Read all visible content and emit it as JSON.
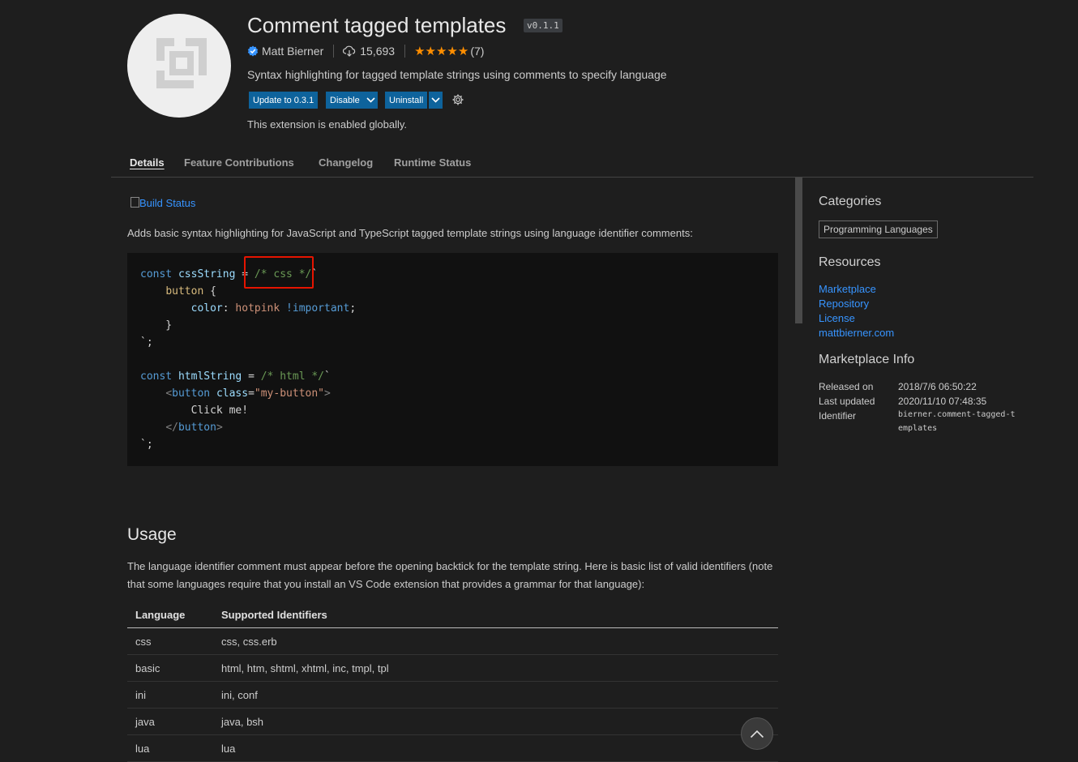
{
  "header": {
    "title": "Comment tagged templates",
    "version": "v0.1.1",
    "publisher": "Matt Bierner",
    "install_count": "15,693",
    "rating_stars": "★★★★★",
    "rating_count": "(7)",
    "description": "Syntax highlighting for tagged template strings using comments to specify language",
    "update_label": "Update to 0.3.1",
    "disable_label": "Disable",
    "uninstall_label": "Uninstall",
    "status_text": "This extension is enabled globally.",
    "icon_names": [
      "verified-publisher-icon",
      "cloud-download-icon",
      "chevron-down-icon",
      "gear-icon",
      "chevron-up-icon"
    ]
  },
  "tabs": [
    {
      "label": "Details",
      "active": true
    },
    {
      "label": "Feature Contributions",
      "active": false
    },
    {
      "label": "Changelog",
      "active": false
    },
    {
      "label": "Runtime Status",
      "active": false
    }
  ],
  "content": {
    "build_badge_alt": "Build Status",
    "intro": "Adds basic syntax highlighting for JavaScript and TypeScript tagged template strings using language identifier comments:",
    "code_text": "const cssString = /* css */`\n    button {\n        color: hotpink !important;\n    }\n`;\n\nconst htmlString = /* html */`\n    <button class=\"my-button\">\n        Click me!\n    </button>\n`;",
    "usage_heading": "Usage",
    "usage_text": "The language identifier comment must appear before the opening backtick for the template string. Here is basic list of valid identifiers (note that some languages require that you install an VS Code extension that provides a grammar for that language):",
    "table": {
      "headers": [
        "Language",
        "Supported Identifiers"
      ],
      "rows": [
        [
          "css",
          "css, css.erb"
        ],
        [
          "basic",
          "html, htm, shtml, xhtml, inc, tmpl, tpl"
        ],
        [
          "ini",
          "ini, conf"
        ],
        [
          "java",
          "java, bsh"
        ],
        [
          "lua",
          "lua"
        ]
      ]
    }
  },
  "sidebar": {
    "categories_heading": "Categories",
    "category": "Programming Languages",
    "resources_heading": "Resources",
    "links": [
      "Marketplace",
      "Repository",
      "License",
      "mattbierner.com"
    ],
    "info_heading": "Marketplace Info",
    "released_label": "Released on",
    "released_value": "2018/7/6 06:50:22",
    "updated_label": "Last updated",
    "updated_value": "2020/11/10 07:48:35",
    "identifier_label": "Identifier",
    "identifier_value": "bierner.comment-tagged-templates"
  },
  "colors": {
    "background": "#1e1e1e",
    "button": "#0e639c",
    "link": "#3794ff",
    "star": "#ff8e00",
    "highlight_box": "#e51400"
  }
}
